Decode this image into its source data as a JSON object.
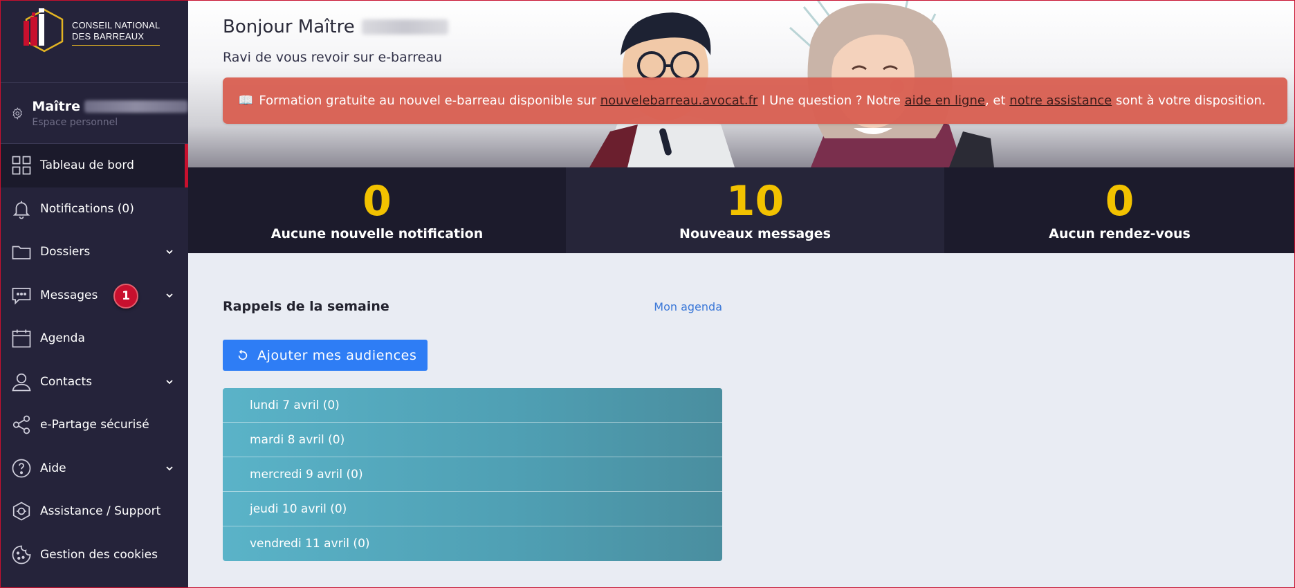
{
  "brand": {
    "line1": "CONSEIL NATIONAL",
    "line2": "DES BARREAUX",
    "colors": {
      "red": "#c8102e",
      "gold": "#e3b423"
    }
  },
  "user": {
    "title": "Maître",
    "subtitle": "Espace personnel"
  },
  "sidebar": {
    "items": [
      {
        "label": "Tableau de bord",
        "icon": "dashboard-icon",
        "active": true,
        "chevron": false
      },
      {
        "label": "Notifications (0)",
        "icon": "bell-icon",
        "active": false,
        "chevron": false
      },
      {
        "label": "Dossiers",
        "icon": "folder-icon",
        "active": false,
        "chevron": true
      },
      {
        "label": "Messages",
        "icon": "chat-icon",
        "active": false,
        "chevron": true,
        "badge": "1"
      },
      {
        "label": "Agenda",
        "icon": "calendar-icon",
        "active": false,
        "chevron": false
      },
      {
        "label": "Contacts",
        "icon": "person-icon",
        "active": false,
        "chevron": true
      },
      {
        "label": "e-Partage sécurisé",
        "icon": "share-icon",
        "active": false,
        "chevron": false
      },
      {
        "label": "Aide",
        "icon": "help-icon",
        "active": false,
        "chevron": true
      },
      {
        "label": "Assistance / Support",
        "icon": "support-icon",
        "active": false,
        "chevron": false
      },
      {
        "label": "Gestion des cookies",
        "icon": "cookie-icon",
        "active": false,
        "chevron": false
      }
    ]
  },
  "hero": {
    "greeting": "Bonjour Maître",
    "subtitle": "Ravi de vous revoir sur e-barreau"
  },
  "alert": {
    "icon": "📖",
    "text1": "Formation gratuite au nouvel e-barreau disponible sur",
    "link1": "nouvelebarreau.avocat.fr",
    "text2": "I Une question ? Notre",
    "link2": "aide en ligne",
    "text3": ", et",
    "link3": "notre assistance",
    "text4": "sont à votre disposition."
  },
  "stats": [
    {
      "value": "0",
      "label": "Aucune nouvelle notification"
    },
    {
      "value": "10",
      "label": "Nouveaux messages"
    },
    {
      "value": "0",
      "label": "Aucun rendez-vous"
    }
  ],
  "reminders": {
    "title": "Rappels de la semaine",
    "agenda_link": "Mon agenda",
    "add_button": "Ajouter mes audiences",
    "days": [
      "lundi 7 avril (0)",
      "mardi 8 avril (0)",
      "mercredi 9 avril (0)",
      "jeudi 10 avril (0)",
      "vendredi 11 avril (0)"
    ]
  }
}
